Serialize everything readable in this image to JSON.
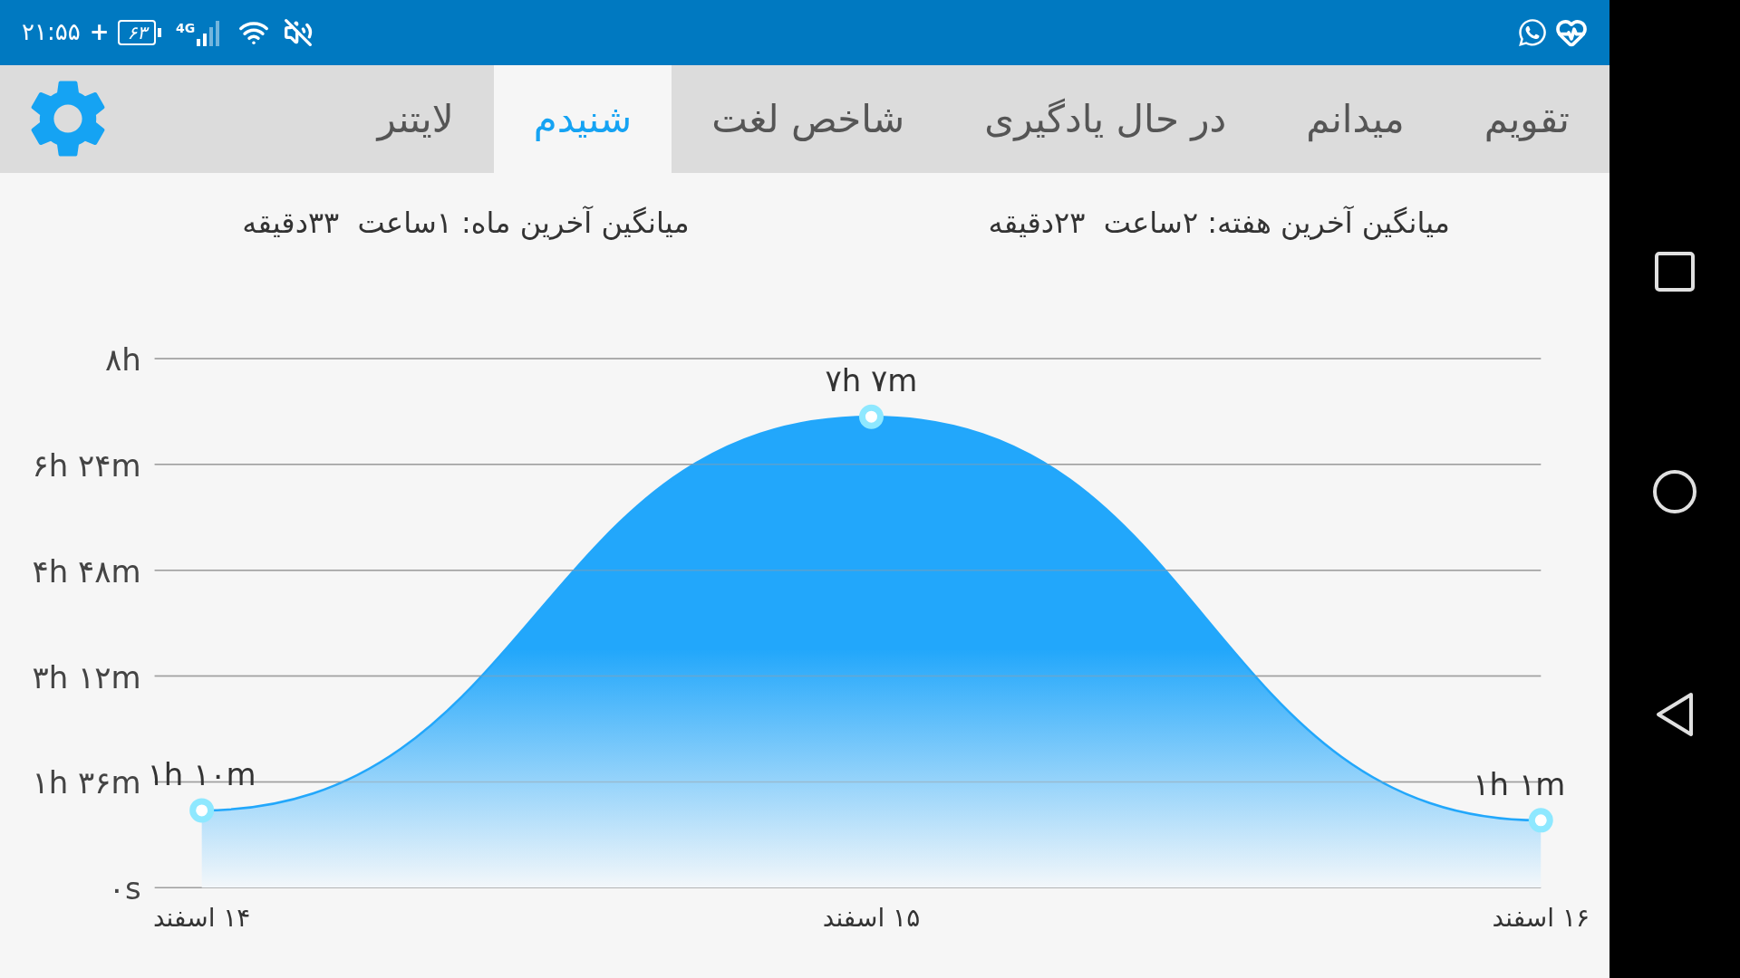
{
  "status_bar": {
    "time": "۲۱:۵۵",
    "plus": "+",
    "battery": "۶۳",
    "network": "4G"
  },
  "tabs": [
    {
      "label": "تقویم",
      "selected": false
    },
    {
      "label": "میدانم",
      "selected": false
    },
    {
      "label": "در حال یادگیری",
      "selected": false
    },
    {
      "label": "شاخص لغت",
      "selected": false
    },
    {
      "label": "شنیدم",
      "selected": true
    },
    {
      "label": "لایتنر",
      "selected": false
    }
  ],
  "averages": [
    "میانگین آخرین هفته: ۲ساعت  ۲۳دقیقه",
    "میانگین آخرین ماه: ۱ساعت  ۳۳دقیقه"
  ],
  "chart": {
    "chart_data": {
      "type": "area",
      "categories": [
        "۱۴ اسفند",
        "۱۵ اسفند",
        "۱۶ اسفند"
      ],
      "series": [
        {
          "color": "#22a7fb",
          "values": [
            1.17,
            7.12,
            1.02
          ]
        }
      ],
      "ylim": [
        0,
        8
      ],
      "grid": true,
      "yticks": [
        {
          "value": 0,
          "label": "۰s"
        },
        {
          "value": 1.6,
          "label": "۱h ۳۶m"
        },
        {
          "value": 3.2,
          "label": "۳h ۱۲m"
        },
        {
          "value": 4.8,
          "label": "۴h ۴۸m"
        },
        {
          "value": 6.4,
          "label": "۶h ۲۴m"
        },
        {
          "value": 8,
          "label": "۸h"
        }
      ],
      "value_labels": [
        "۱h ۱۰m",
        "۷h ۷m",
        "۱h ۱m"
      ]
    }
  }
}
